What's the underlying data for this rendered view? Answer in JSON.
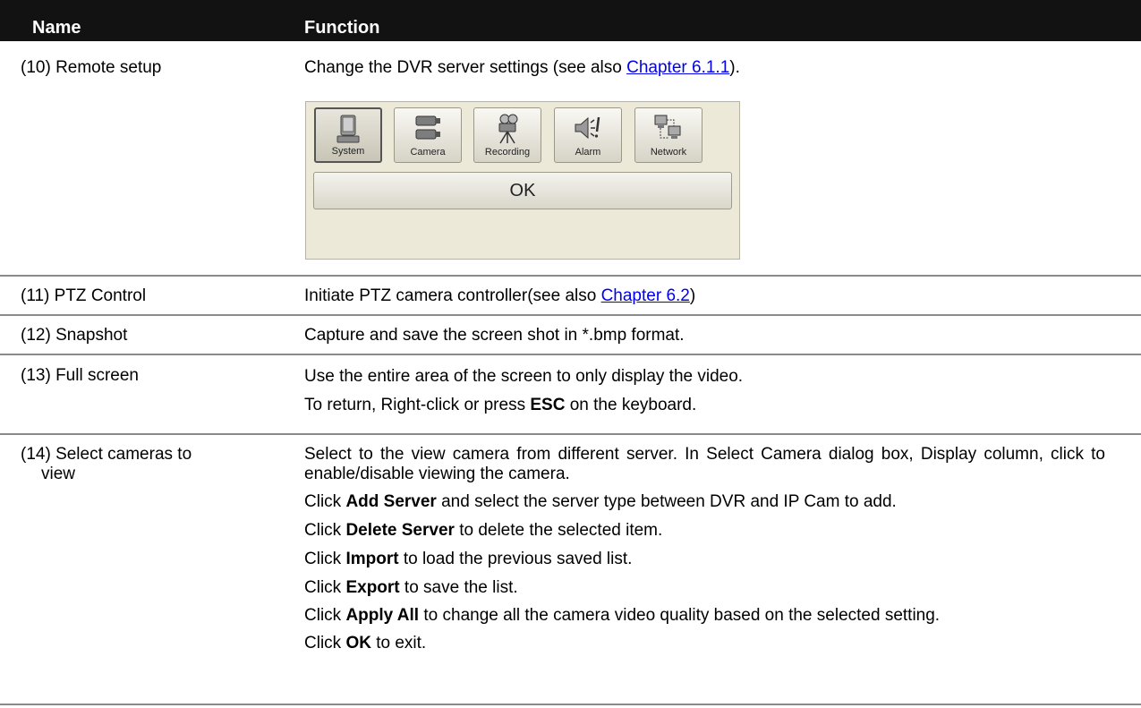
{
  "header": {
    "name_col": "Name",
    "function_col": "Function"
  },
  "rows": [
    {
      "name": "(10) Remote setup",
      "desc_before": "Change the DVR server settings (see also ",
      "desc_link": "Chapter 6.1.1",
      "desc_after": ").",
      "dialog": {
        "buttons": [
          {
            "label": "System",
            "icon": "computer-icon"
          },
          {
            "label": "Camera",
            "icon": "camera-icon"
          },
          {
            "label": "Recording",
            "icon": "video-camera-icon"
          },
          {
            "label": "Alarm",
            "icon": "alarm-speaker-icon"
          },
          {
            "label": "Network",
            "icon": "network-icon"
          }
        ],
        "ok_label": "OK"
      }
    },
    {
      "name": "(11) PTZ Control",
      "desc_before": "Initiate PTZ camera controller(see also ",
      "desc_link": "Chapter 6.2",
      "desc_after": ")"
    },
    {
      "name": "(12) Snapshot",
      "desc": "Capture and save the screen shot in *.bmp format."
    },
    {
      "name": "(13) Full screen",
      "desc1": "Use the entire area of the screen to only display the video.",
      "desc2_before": "To return, Right-click or press ",
      "desc2_bold": "ESC",
      "desc2_after": " on the keyboard."
    },
    {
      "name_line1": "(14) Select cameras to",
      "name_line2": "view",
      "p1": "Select to the view camera from different server. In Select Camera dialog box, Display column, click to enable/disable viewing the camera.",
      "p2": {
        "pre": "Click ",
        "bold": "Add Server",
        "post": " and select the server type between DVR and IP Cam to add."
      },
      "p3": {
        "pre": "Click ",
        "bold": "Delete Server",
        "post": " to delete the selected item."
      },
      "p4": {
        "pre": "Click ",
        "bold": "Import",
        "post": " to load the previous saved list."
      },
      "p5": {
        "pre": "Click ",
        "bold": "Export",
        "post": " to save the list."
      },
      "p6": {
        "pre": "Click ",
        "bold": "Apply All",
        "post": " to change all the camera video quality based on the selected setting."
      },
      "p7": {
        "pre": "Click ",
        "bold": "OK",
        "post": " to exit."
      }
    }
  ]
}
